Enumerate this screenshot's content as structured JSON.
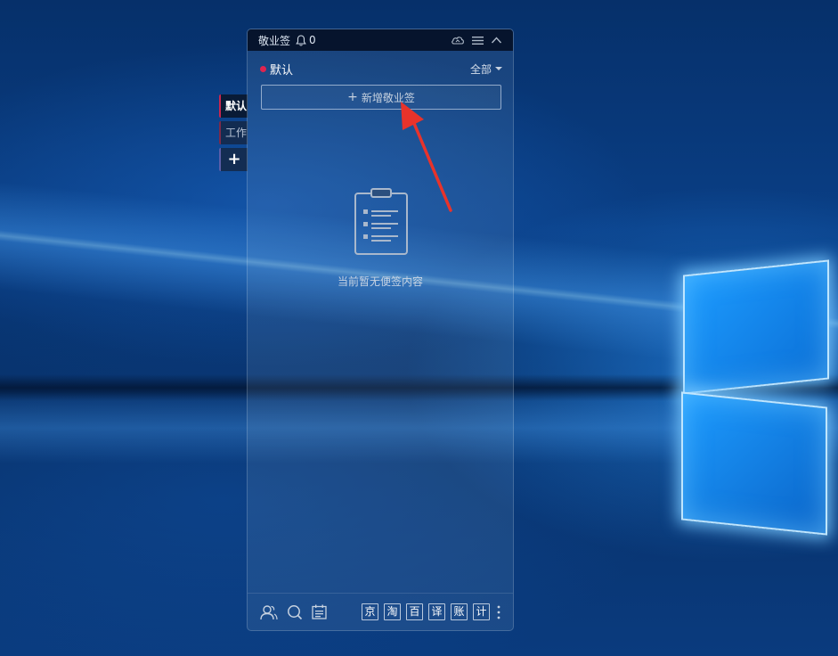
{
  "window": {
    "title": "敬业签",
    "notification_count": "0"
  },
  "side_tabs": [
    {
      "label": "默认"
    },
    {
      "label": "工作"
    },
    {
      "label": "+"
    }
  ],
  "header": {
    "category": "默认",
    "filter": "全部"
  },
  "add_button": {
    "plus": "+",
    "label": "新增敬业签"
  },
  "empty_state": {
    "text": "当前暂无便签内容"
  },
  "footer": {
    "shortcuts": [
      "京",
      "淘",
      "百",
      "译",
      "账",
      "计"
    ]
  },
  "colors": {
    "accent_red": "#e0244f",
    "annotation_arrow": "#e8332b"
  }
}
